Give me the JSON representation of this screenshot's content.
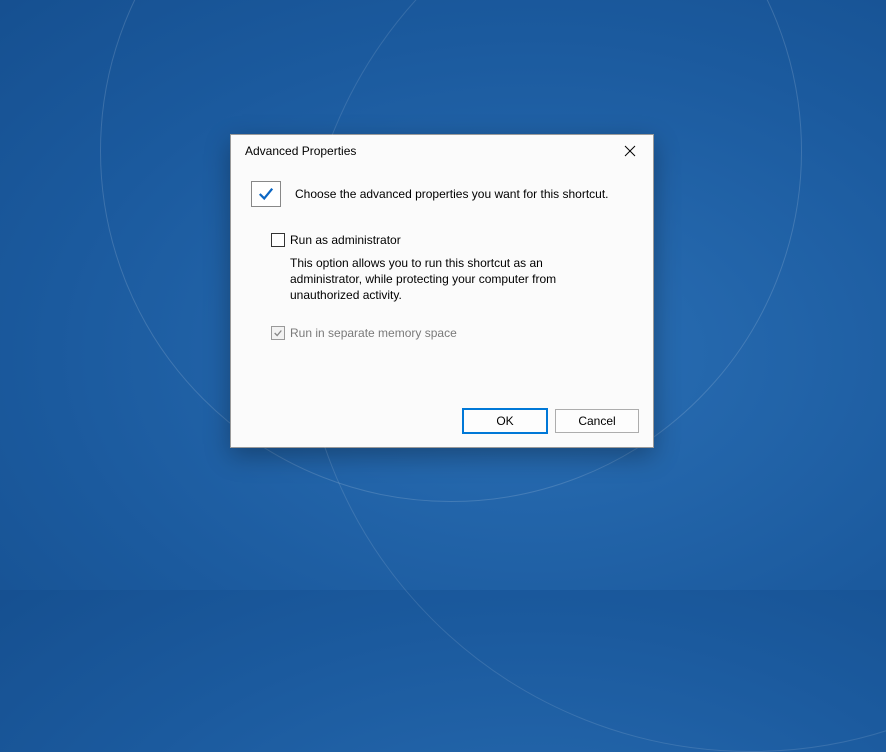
{
  "dialog": {
    "title": "Advanced Properties",
    "header_text": "Choose the advanced properties you want for this shortcut.",
    "options": {
      "run_as_admin": {
        "label": "Run as administrator",
        "description": "This option allows you to run this shortcut as an administrator, while protecting your computer from unauthorized activity.",
        "checked": false,
        "enabled": true
      },
      "separate_memory": {
        "label": "Run in separate memory space",
        "checked": true,
        "enabled": false
      }
    },
    "buttons": {
      "ok": "OK",
      "cancel": "Cancel"
    }
  }
}
